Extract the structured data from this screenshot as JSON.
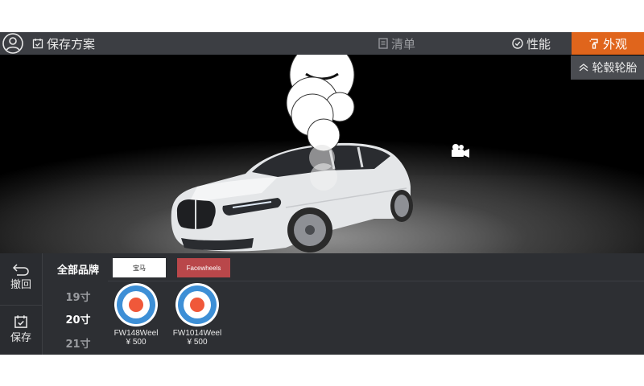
{
  "topbar": {
    "save_plan": "保存方案",
    "list": "清单",
    "performance": "性能",
    "appearance": "外观",
    "submenu_rims_tires": "轮毂轮胎"
  },
  "sidebar": {
    "undo": "撤回",
    "save": "保存"
  },
  "brand_filter": {
    "all_brands": "全部品牌",
    "sizes": [
      {
        "label": "19寸",
        "active": false
      },
      {
        "label": "20寸",
        "active": true
      },
      {
        "label": "21寸",
        "active": false
      }
    ]
  },
  "brand_tabs": [
    {
      "label": "宝马"
    },
    {
      "label": "Facewheels"
    }
  ],
  "wheels": [
    {
      "name": "FW148Weel",
      "price": "¥ 500"
    },
    {
      "name": "FW1014Weel",
      "price": "¥ 500"
    }
  ],
  "colors": {
    "accent": "#e0651c",
    "topbar": "#3c3e43",
    "panel": "#2d2f33",
    "facewheels_tab": "#b9474a",
    "wheel_blue": "#3d8fd6",
    "wheel_red": "#f0583a"
  },
  "icons": {
    "avatar": "user-icon",
    "save_plan": "calendar-check-icon",
    "list": "document-icon",
    "performance": "gauge-icon",
    "appearance": "paint-icon",
    "submenu": "double-chevron-up-icon",
    "undo": "undo-arrow-icon",
    "save": "calendar-check-icon",
    "camera": "video-camera-icon"
  }
}
